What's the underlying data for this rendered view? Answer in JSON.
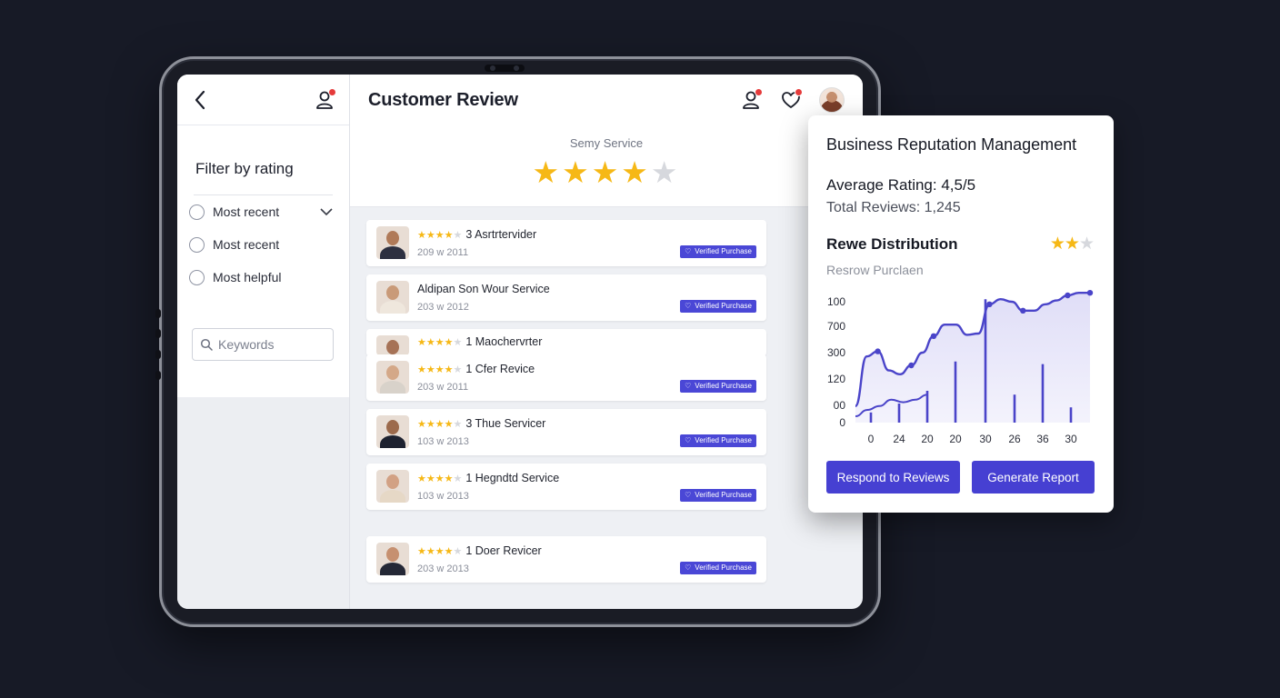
{
  "sidebar": {
    "filter_title": "Filter by rating",
    "options": [
      "Most recent",
      "Most recent",
      "Most helpful"
    ],
    "search_placeholder": "Keywords"
  },
  "header": {
    "title": "Customer Review"
  },
  "summary": {
    "service_label": "Semy Service",
    "rating_stars": 4,
    "max_stars": 5
  },
  "reviews": [
    {
      "stars": 4,
      "title": "3 Asrtrtervider",
      "date": "209 w 2011",
      "badge": "Verified Purchase"
    },
    {
      "stars": 0,
      "title": "Aldipan Son Wour Service",
      "date": "203 w 2012",
      "badge": "Verified Purchase"
    },
    {
      "stars": 4,
      "title": "1 Maochervrter",
      "date": "",
      "badge": ""
    },
    {
      "stars": 4,
      "title": "1 Cfer Revice",
      "date": "203 w 2011",
      "badge": "Verified Purchase"
    },
    {
      "stars": 4,
      "title": "3 Thue Servicer",
      "date": "103 w 2013",
      "badge": "Verified Purchase"
    },
    {
      "stars": 4,
      "title": "1 Hegndtd Service",
      "date": "103 w 2013",
      "badge": "Verified Purchase"
    },
    {
      "stars": 4,
      "title": "1 Doer Revicer",
      "date": "203 w 2013",
      "badge": "Verified Purchase"
    }
  ],
  "card": {
    "title": "Business Reputation Management",
    "average_rating": "Average Rating: 4,5/5",
    "total_reviews": "Total Reviews: 1,245",
    "distribution_title": "Rewe Distribution",
    "distribution_stars": 2,
    "distribution_max": 3,
    "subtitle": "Resrow Purclaen",
    "respond_button": "Respond to Reviews",
    "report_button": "Generate Report"
  },
  "chart_data": {
    "type": "area",
    "yticks": [
      "100",
      "700",
      "300",
      "120",
      "00",
      "0"
    ],
    "xticks": [
      "0",
      "24",
      "20",
      "20",
      "30",
      "26",
      "36",
      "30"
    ],
    "area_points": [
      0.13,
      0.52,
      0.56,
      0.41,
      0.38,
      0.45,
      0.55,
      0.68,
      0.77,
      0.77,
      0.69,
      0.7,
      0.93,
      0.97,
      0.95,
      0.88,
      0.88,
      0.93,
      0.96,
      1.0,
      1.04,
      1.05
    ],
    "lower_line": [
      0.05,
      0.1,
      0.13,
      0.18,
      0.16,
      0.18,
      0.22
    ],
    "bars": [
      0.08,
      0.15,
      0.25,
      0.48,
      0.97,
      0.22,
      0.46,
      0.12
    ],
    "colors": {
      "line": "#4a44c9",
      "fill": "#dedcf7",
      "bar": "#4a44c9"
    }
  }
}
